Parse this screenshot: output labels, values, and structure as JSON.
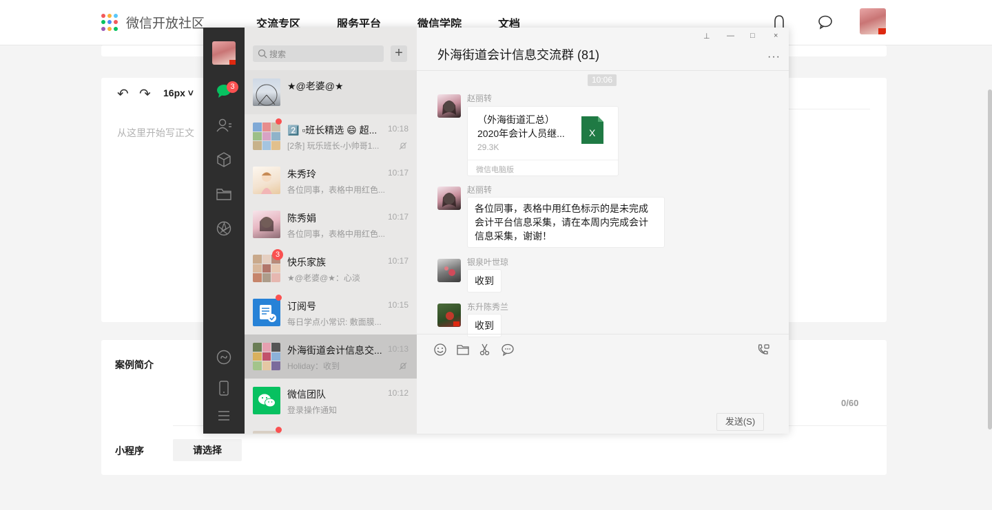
{
  "nav": {
    "logo_text": "微信开放社区",
    "logo_colors": [
      "#f25a5a",
      "#fbb33a",
      "#5ac8fa",
      "#07c160",
      "#4c8bf5",
      "#f25a5a",
      "#9b59b6",
      "#fbb33a",
      "#07c160"
    ],
    "items": [
      {
        "label": "交流专区"
      },
      {
        "label": "服务平台"
      },
      {
        "label": "微信学院"
      },
      {
        "label": "文档"
      }
    ],
    "icons": [
      "bell-icon",
      "chat-bubble-icon"
    ]
  },
  "editor": {
    "font_size": "16px",
    "placeholder": "从这里开始写正文"
  },
  "case": {
    "label": "案例简介",
    "count": "0/60"
  },
  "miniprogram": {
    "label": "小程序",
    "select_label": "请选择"
  },
  "wechat": {
    "sidebar_badge": "3",
    "search_placeholder": "搜索",
    "add_label": "+",
    "chats": [
      {
        "name": "★@老婆@★",
        "preview": "",
        "time": "",
        "muted": false,
        "pinned": true
      },
      {
        "name": "2️⃣ ▫班长精选 😄 超...",
        "preview": "[2条] 玩乐班长-小帅哥1...",
        "time": "10:18",
        "muted": true,
        "dot": true
      },
      {
        "name": "朱秀玲",
        "preview": "各位同事，表格中用红色...",
        "time": "10:17"
      },
      {
        "name": "陈秀娟",
        "preview": "各位同事，表格中用红色...",
        "time": "10:17"
      },
      {
        "name": "快乐家族",
        "preview": "★@老婆@★：心淡",
        "time": "10:17",
        "badge": "3"
      },
      {
        "name": "订阅号",
        "preview": "每日学点小常识: 敷面膜...",
        "time": "10:15",
        "dot": true
      },
      {
        "name": "外海街道会计信息交...",
        "preview": "Holiday：收到",
        "time": "10:13",
        "muted": true,
        "active": true
      },
      {
        "name": "微信团队",
        "preview": "登录操作通知",
        "time": "10:12"
      }
    ],
    "window_controls": [
      "⊥",
      "—",
      "□",
      "×"
    ],
    "title": "外海街道会计信息交流群 (81)",
    "more": "···",
    "timestamp": "10:06",
    "messages": [
      {
        "sender": "赵丽转",
        "type": "file",
        "file_name": "（外海街道汇总）2020年会计人员继...",
        "file_size": "29.3K",
        "file_source": "微信电脑版"
      },
      {
        "sender": "赵丽转",
        "type": "text",
        "text": "各位同事，表格中用红色标示的是未完成会计平台信息采集，请在本周内完成会计信息采集，谢谢！"
      },
      {
        "sender": "银泉叶世琼",
        "type": "text",
        "text": "收到"
      },
      {
        "sender": "东升陈秀兰",
        "type": "text",
        "text": "收到"
      }
    ],
    "send_label": "发送(S)",
    "accent": "#07c160",
    "badge_color": "#fa5151"
  }
}
